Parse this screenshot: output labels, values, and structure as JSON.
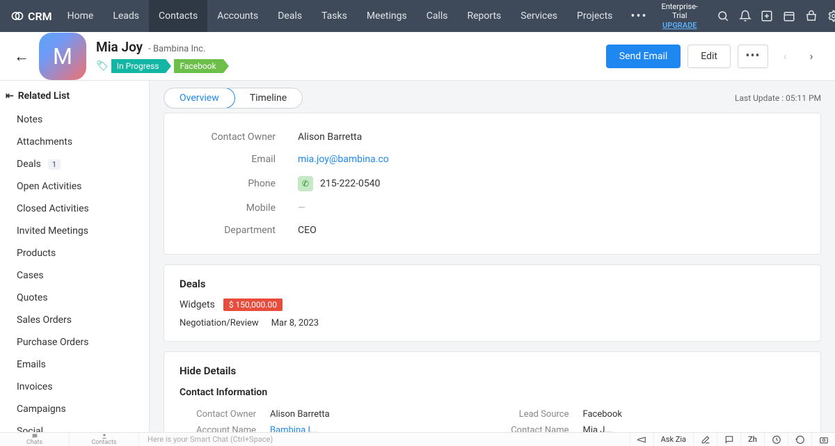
{
  "app": {
    "name": "CRM"
  },
  "nav": [
    "Home",
    "Leads",
    "Contacts",
    "Accounts",
    "Deals",
    "Tasks",
    "Meetings",
    "Calls",
    "Reports",
    "Services",
    "Projects"
  ],
  "nav_active": "Contacts",
  "trial": {
    "label": "Enterprise-Trial",
    "upgrade": "UPGRADE"
  },
  "contact": {
    "initial": "M",
    "name": "Mia Joy",
    "company": "Bambina Inc.",
    "tags": [
      {
        "label": "In Progress",
        "cls": "teal"
      },
      {
        "label": "Facebook",
        "cls": "green"
      }
    ]
  },
  "actions": {
    "send": "Send Email",
    "edit": "Edit"
  },
  "sidebar": {
    "title": "Related List",
    "items": [
      {
        "label": "Notes"
      },
      {
        "label": "Attachments"
      },
      {
        "label": "Deals",
        "badge": "1"
      },
      {
        "label": "Open Activities"
      },
      {
        "label": "Closed Activities"
      },
      {
        "label": "Invited Meetings"
      },
      {
        "label": "Products"
      },
      {
        "label": "Cases"
      },
      {
        "label": "Quotes"
      },
      {
        "label": "Sales Orders"
      },
      {
        "label": "Purchase Orders"
      },
      {
        "label": "Emails"
      },
      {
        "label": "Invoices"
      },
      {
        "label": "Campaigns"
      },
      {
        "label": "Social"
      }
    ]
  },
  "tabs": {
    "overview": "Overview",
    "timeline": "Timeline"
  },
  "last_update": "Last Update : 05:11 PM",
  "summary": {
    "owner_label": "Contact Owner",
    "owner": "Alison Barretta",
    "email_label": "Email",
    "email": "mia.joy@bambina.co",
    "phone_label": "Phone",
    "phone": "215-222-0540",
    "mobile_label": "Mobile",
    "mobile": "—",
    "dept_label": "Department",
    "dept": "CEO"
  },
  "deals": {
    "title": "Deals",
    "name": "Widgets",
    "amount": "$ 150,000.00",
    "stage": "Negotiation/Review",
    "date": "Mar 8, 2023"
  },
  "details": {
    "hide": "Hide Details",
    "section": "Contact Information",
    "left": [
      {
        "label": "Contact Owner",
        "value": "Alison Barretta"
      },
      {
        "label": "Account Name",
        "value": "Bambina I...",
        "link": true
      }
    ],
    "right": [
      {
        "label": "Lead Source",
        "value": "Facebook"
      },
      {
        "label": "Contact Name",
        "value": "Mia J..."
      }
    ]
  },
  "footer": {
    "chats": "Chats",
    "contacts": "Contacts",
    "smartchat": "Here is your Smart Chat (Ctrl+Space)",
    "askzia": "Ask Zia"
  }
}
